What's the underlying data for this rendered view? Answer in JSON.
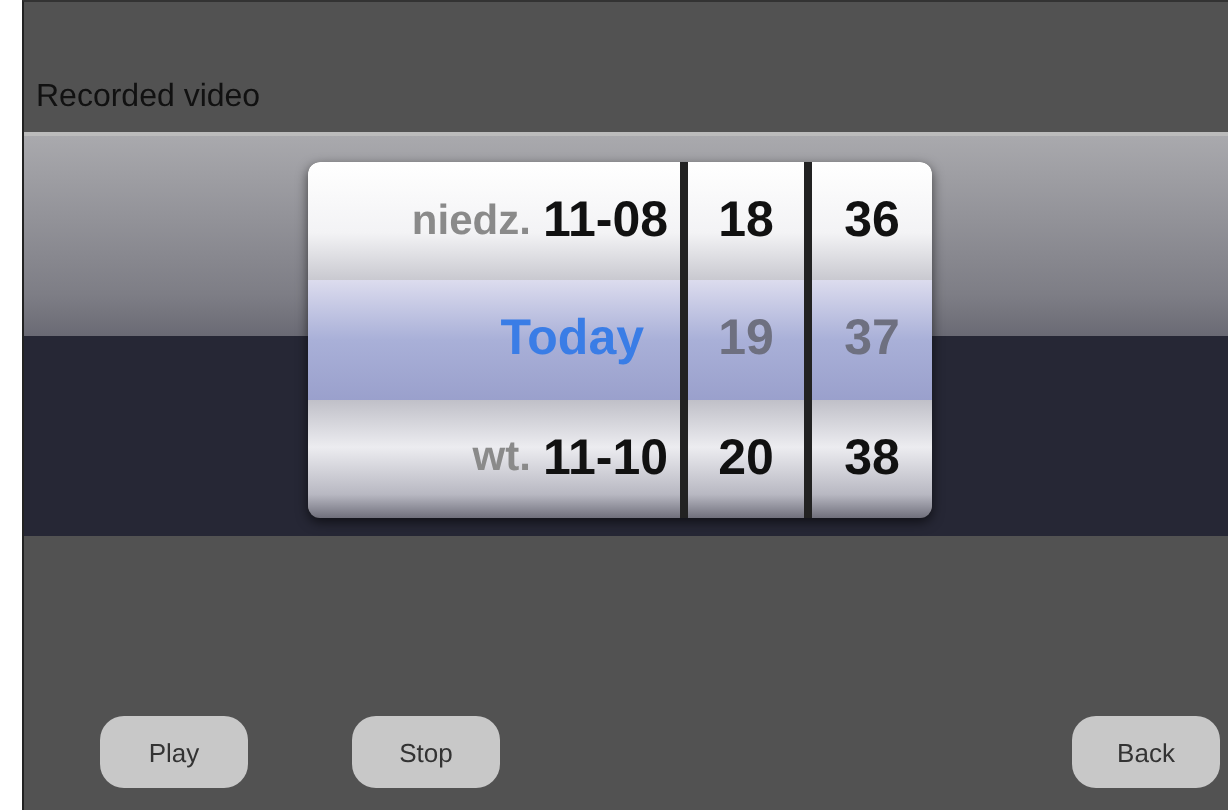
{
  "title": "Recorded video",
  "picker": {
    "rows": [
      {
        "weekday": "niedz.",
        "date": "11-08",
        "hour": "18",
        "minute": "36",
        "selected": false
      },
      {
        "date": "Today",
        "hour": "19",
        "minute": "37",
        "selected": true
      },
      {
        "weekday": "wt.",
        "date": "11-10",
        "hour": "20",
        "minute": "38",
        "selected": false
      }
    ]
  },
  "left_buttons": [
    "Play",
    "Stop"
  ],
  "right_buttons": [
    "Back"
  ]
}
